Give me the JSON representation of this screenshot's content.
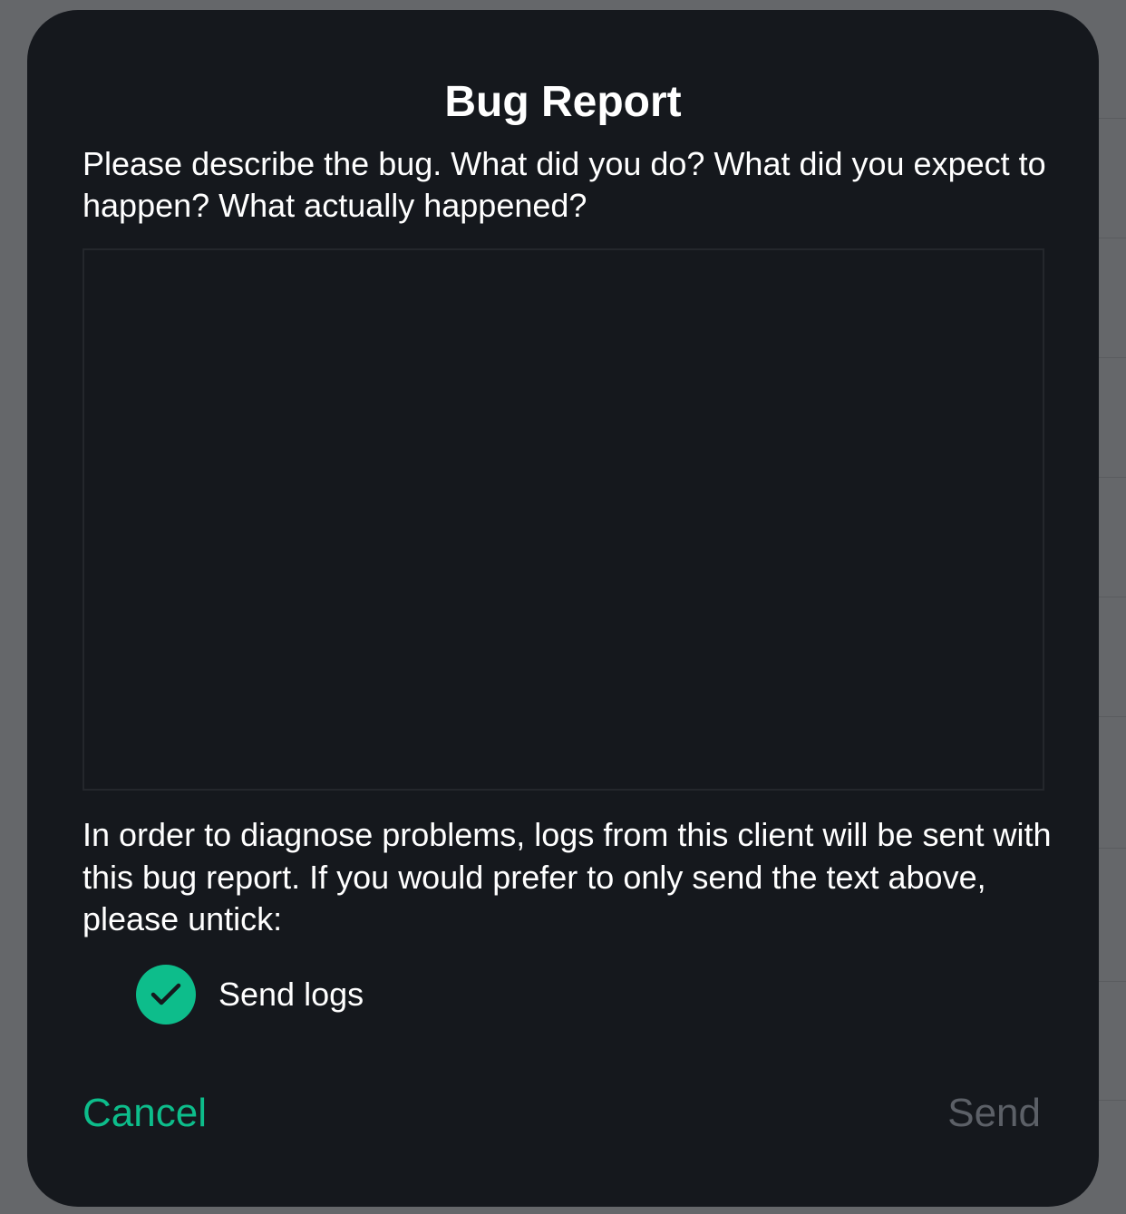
{
  "dialog": {
    "title": "Bug Report",
    "prompt": "Please describe the bug. What did you do? What did you expect to happen? What actually happened?",
    "description_value": "",
    "logs_notice": "In order to diagnose problems, logs from this client will be sent with this bug report. If you would prefer to only send the text above, please untick:",
    "send_logs": {
      "label": "Send logs",
      "checked": true
    },
    "cancel_label": "Cancel",
    "send_label": "Send"
  },
  "colors": {
    "accent": "#0dbd8b",
    "dialog_background": "#15181d",
    "disabled_text": "#5c6067",
    "backdrop": "#65676a"
  },
  "icons": {
    "send_logs_check": "checkmark-icon"
  }
}
